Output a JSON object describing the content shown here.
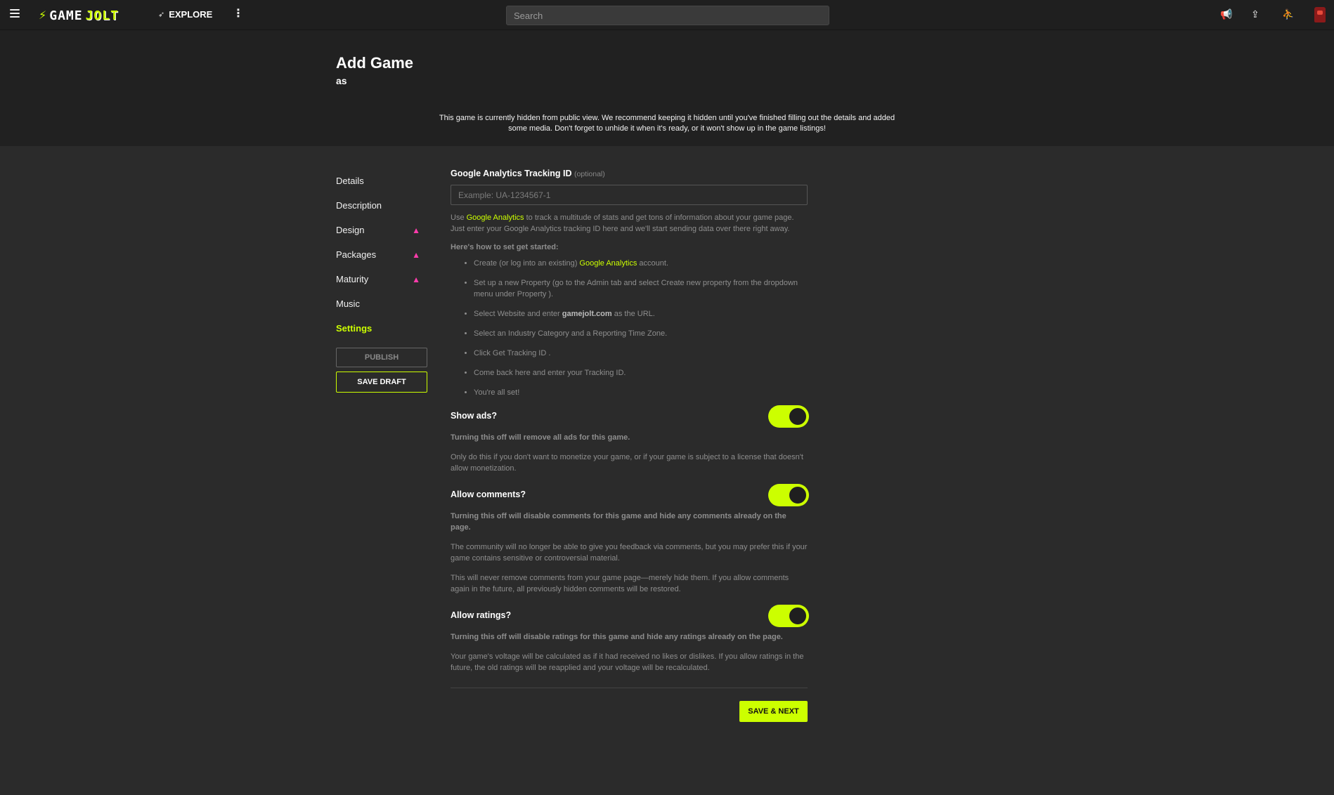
{
  "topbar": {
    "logo_word1": "GAME",
    "logo_word2": "JOLT",
    "explore_label": "EXPLORE",
    "search_placeholder": "Search",
    "icons": [
      "menu-icon",
      "compass-icon",
      "more-vert-icon",
      "megaphone-icon",
      "upload-icon",
      "friends-icon",
      "avatar-icon"
    ]
  },
  "header": {
    "title": "Add Game",
    "subtitle": "as",
    "notice": "This game is currently hidden from public view. We recommend keeping it hidden until you've finished filling out the details and added some media. Don't forget to unhide it when it's ready, or it won't show up in the game listings!"
  },
  "sidebar": {
    "items": [
      {
        "label": "Details",
        "warning": false,
        "active": false
      },
      {
        "label": "Description",
        "warning": false,
        "active": false
      },
      {
        "label": "Design",
        "warning": true,
        "active": false
      },
      {
        "label": "Packages",
        "warning": true,
        "active": false
      },
      {
        "label": "Maturity",
        "warning": true,
        "active": false
      },
      {
        "label": "Music",
        "warning": false,
        "active": false
      },
      {
        "label": "Settings",
        "warning": false,
        "active": true
      }
    ],
    "publish_label": "PUBLISH",
    "save_draft_label": "SAVE DRAFT"
  },
  "form": {
    "ga_label": "Google Analytics Tracking ID",
    "ga_optional": "(optional)",
    "ga_placeholder": "Example: UA-1234567-1",
    "ga_value": "",
    "help_pre": "Use ",
    "help_link": "Google Analytics",
    "help_post": " to track a multitude of stats and get tons of information about your game page. Just enter your Google Analytics tracking ID here and we'll start sending data over there right away.",
    "howto_heading": "Here's how to set get started:",
    "steps": {
      "s1_pre": "Create (or log into an existing) ",
      "s1_link": "Google Analytics",
      "s1_post": " account.",
      "s2": "Set up a new Property (go to the Admin tab and select Create new property from the dropdown menu under Property ).",
      "s3_pre": "Select Website and enter ",
      "s3_bold": "gamejolt.com",
      "s3_post": " as the URL.",
      "s4": "Select an Industry Category and a Reporting Time Zone.",
      "s5": "Click Get Tracking ID .",
      "s6": "Come back here and enter your Tracking ID.",
      "s7": "You're all set!"
    },
    "show_ads": {
      "title": "Show ads?",
      "enabled": true,
      "strong": "Turning this off will remove all ads for this game.",
      "note1": "Only do this if you don't want to monetize your game, or if your game is subject to a license that doesn't allow monetization."
    },
    "allow_comments": {
      "title": "Allow comments?",
      "enabled": true,
      "strong": "Turning this off will disable comments for this game and hide any comments already on the page.",
      "note1": "The community will no longer be able to give you feedback via comments, but you may prefer this if your game contains sensitive or controversial material.",
      "note2": "This will never remove comments from your game page—merely hide them. If you allow comments again in the future, all previously hidden comments will be restored."
    },
    "allow_ratings": {
      "title": "Allow ratings?",
      "enabled": true,
      "strong": "Turning this off will disable ratings for this game and hide any ratings already on the page.",
      "note1": "Your game's voltage will be calculated as if it had received no likes or dislikes. If you allow ratings in the future, the old ratings will be reapplied and your voltage will be recalculated."
    },
    "save_next_label": "SAVE & NEXT"
  },
  "colors": {
    "accent": "#ccff00",
    "warning": "#ff3cac",
    "background": "#2b2b2b",
    "topbar": "#1f1f1f"
  }
}
